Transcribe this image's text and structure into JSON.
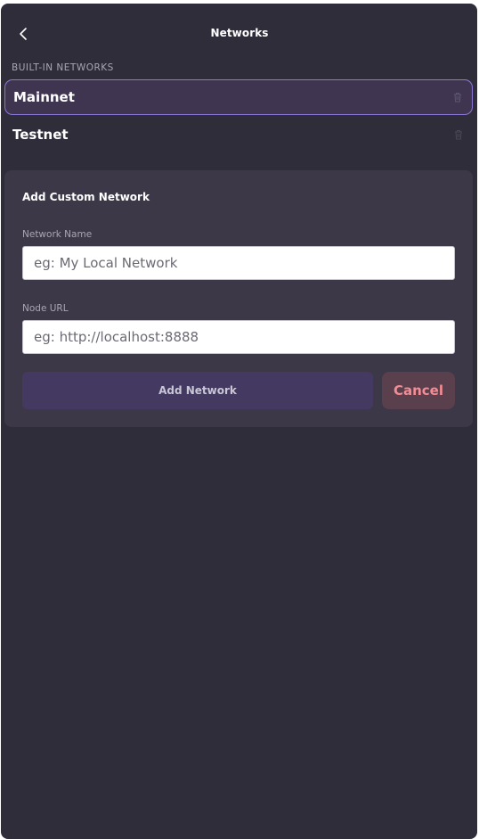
{
  "header": {
    "title": "Networks",
    "back_icon": "chevron-left-icon"
  },
  "built_in": {
    "label": "BUILT-IN NETWORKS",
    "items": [
      {
        "name": "Mainnet",
        "selected": true,
        "icon": "trash-icon"
      },
      {
        "name": "Testnet",
        "selected": false,
        "icon": "trash-icon"
      }
    ]
  },
  "custom": {
    "title": "Add Custom Network",
    "network_name": {
      "label": "Network Name",
      "value": "",
      "placeholder": "eg: My Local Network"
    },
    "node_url": {
      "label": "Node URL",
      "value": "",
      "placeholder": "eg: http://localhost:8888"
    },
    "add_label": "Add Network",
    "cancel_label": "Cancel"
  },
  "colors": {
    "background": "#302d3a",
    "card": "#3c3847",
    "accent_border": "#8b78d6",
    "selected_bg": "#3f3550",
    "primary_button": "#443a61",
    "cancel_text": "#f28c95",
    "cancel_bg": "#5a3f4c"
  }
}
